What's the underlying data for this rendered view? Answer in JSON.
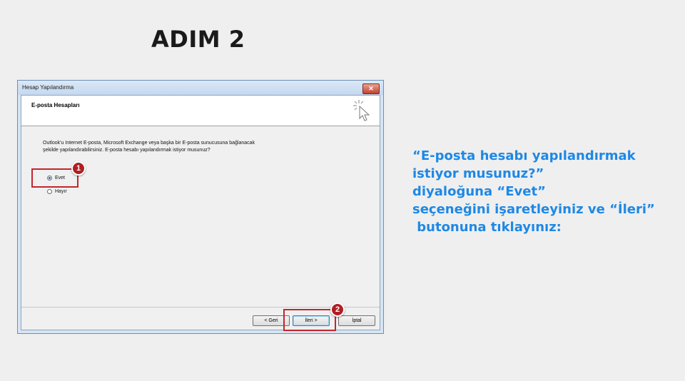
{
  "slide": {
    "title": "ADIM 2",
    "instructions": [
      "“E-posta hesabı yapılandırmak",
      "istiyor musunuz?”",
      "diyaloğuna “Evet”",
      "seçeneğini işaretleyiniz ve “İleri”",
      " butonuna tıklayınız:"
    ]
  },
  "dialog": {
    "title": "Hesap Yapılandırma",
    "close_label": "✕",
    "header": "E-posta Hesapları",
    "question": "Outlook'u Internet E-posta, Microsoft Exchange veya başka bir E-posta sunucusuna bağlanacak şekilde yapılandırabilirsiniz. E-posta hesabı yapılandırmak istiyor musunuz?",
    "options": [
      {
        "label": "Evet",
        "selected": true
      },
      {
        "label": "Hayır",
        "selected": false
      }
    ],
    "buttons": {
      "back": "< Geri",
      "next": "İleri >",
      "cancel": "İptal"
    }
  },
  "annotations": {
    "step1": "1",
    "step2": "2",
    "highlight_color": "#c1272d"
  }
}
